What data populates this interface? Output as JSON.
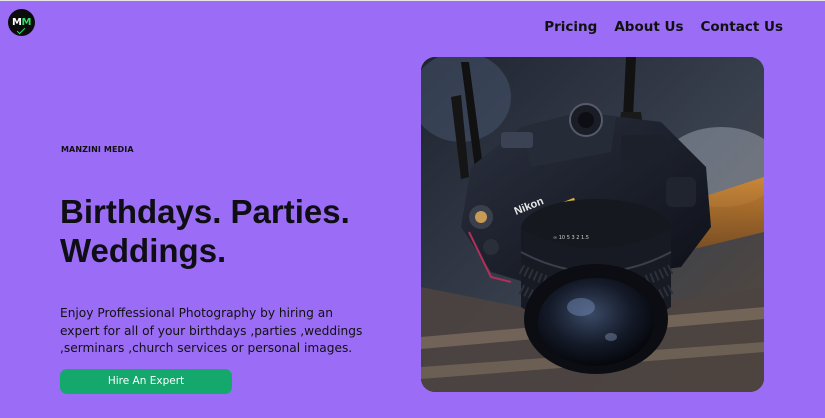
{
  "header": {
    "logo_text": "MM",
    "nav": [
      "Pricing",
      "About Us",
      "Contact Us"
    ]
  },
  "hero": {
    "brand": "MANZINI MEDIA",
    "headline_line1": "Birthdays. Parties.",
    "headline_line2": "Weddings.",
    "description_lines": [
      "Enjoy Proffessional Photography by hiring an",
      "expert for all of your birthdays ,parties ,weddings",
      ",serminars ,church services or personal images."
    ],
    "cta_label": "Hire An Expert",
    "camera_brand": "Nikon",
    "lens_markings": "∞ 10 5 3 2 1.5"
  },
  "colors": {
    "background": "#9b6cf5",
    "cta": "#14a86c",
    "logo_accent": "#2ee06a"
  }
}
